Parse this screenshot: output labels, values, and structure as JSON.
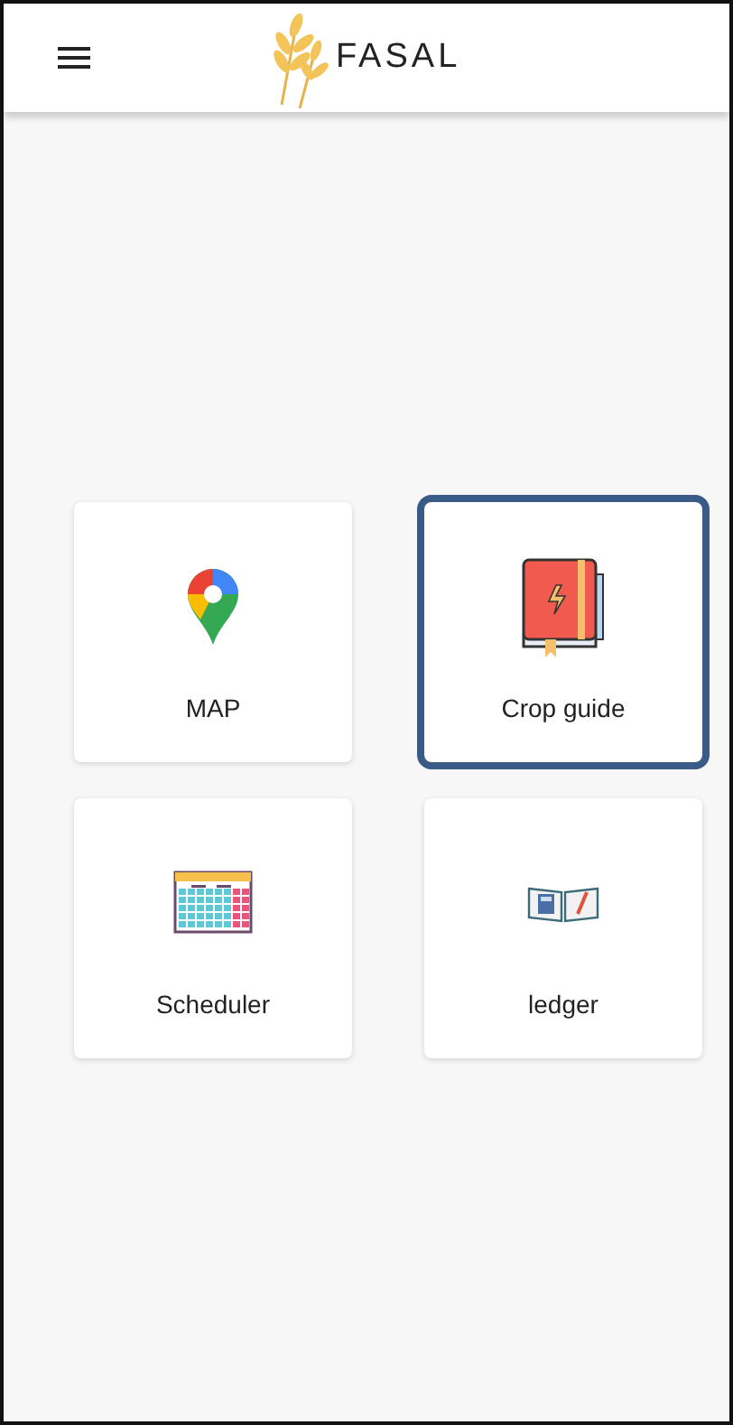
{
  "header": {
    "title": "FASAL"
  },
  "tiles": [
    {
      "label": "MAP",
      "kind": "map",
      "selected": false
    },
    {
      "label": "Crop guide",
      "kind": "guide",
      "selected": true
    },
    {
      "label": "Scheduler",
      "kind": "calendar",
      "selected": false
    },
    {
      "label": "ledger",
      "kind": "ledger",
      "selected": false
    }
  ]
}
